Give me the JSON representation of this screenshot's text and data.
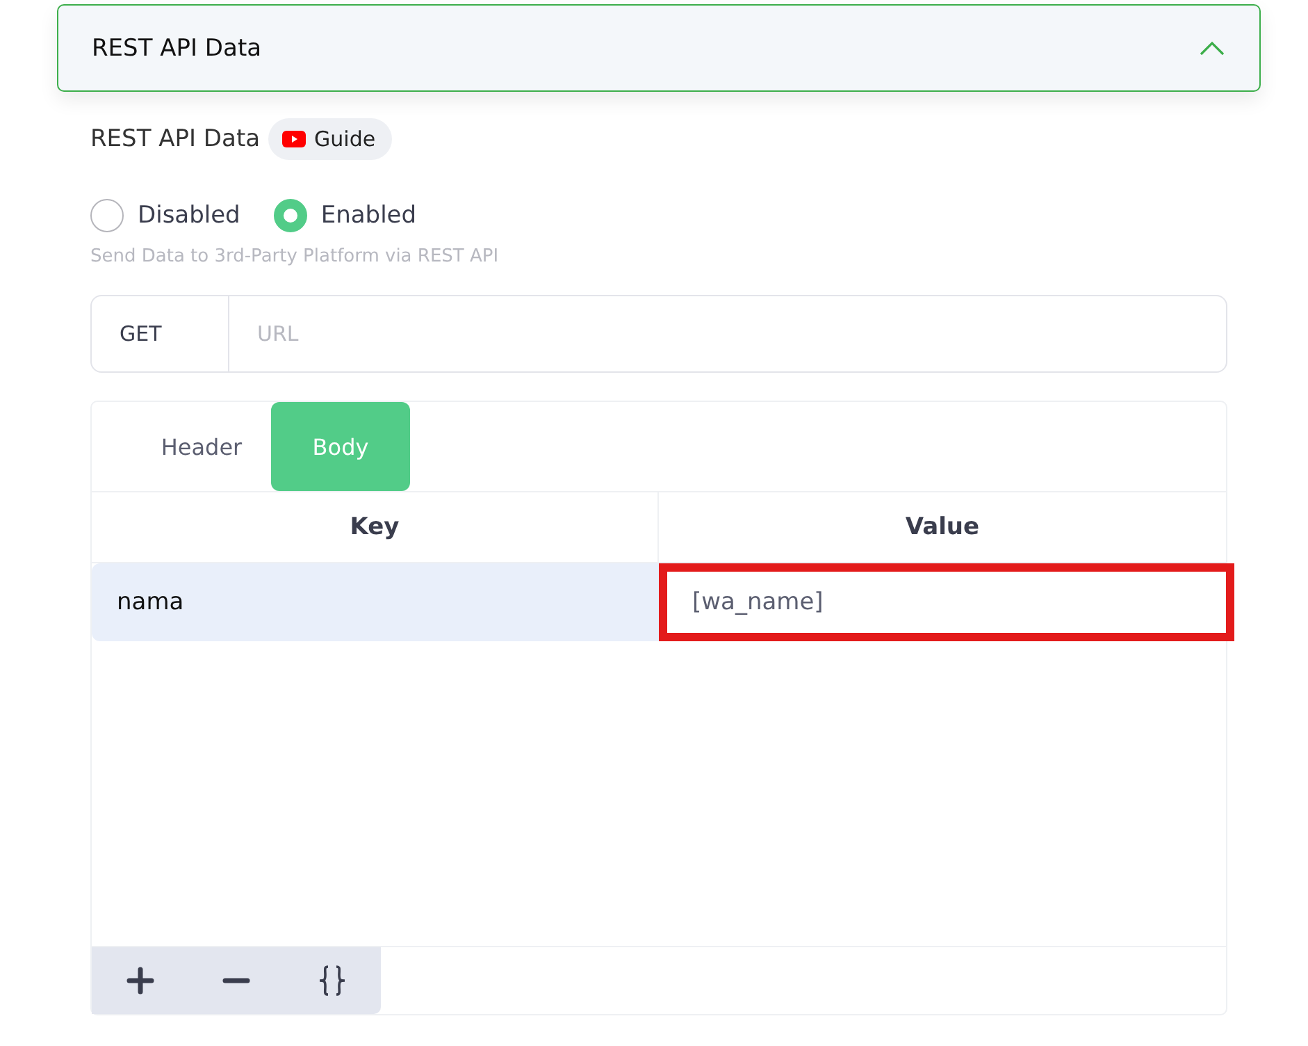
{
  "accordion": {
    "title": "REST API Data",
    "expanded": true
  },
  "section": {
    "title": "REST API Data",
    "guide": "Guide"
  },
  "mode": [
    {
      "label": "Disabled",
      "selected": false
    },
    {
      "label": "Enabled",
      "selected": true
    }
  ],
  "helper": "Send Data to 3rd-Party Platform via REST API",
  "request": {
    "method": "GET",
    "url_placeholder": "URL"
  },
  "tabs": [
    {
      "label": "Header",
      "selected": false
    },
    {
      "label": "Body",
      "selected": true
    }
  ],
  "table": {
    "columns": [
      "Key",
      "Value"
    ],
    "rows": [
      {
        "key": "nama",
        "value": "[wa_name]",
        "highlighted": true
      }
    ]
  },
  "toolbar": [
    {
      "kind": "add"
    },
    {
      "kind": "remove"
    },
    {
      "kind": "json"
    }
  ]
}
